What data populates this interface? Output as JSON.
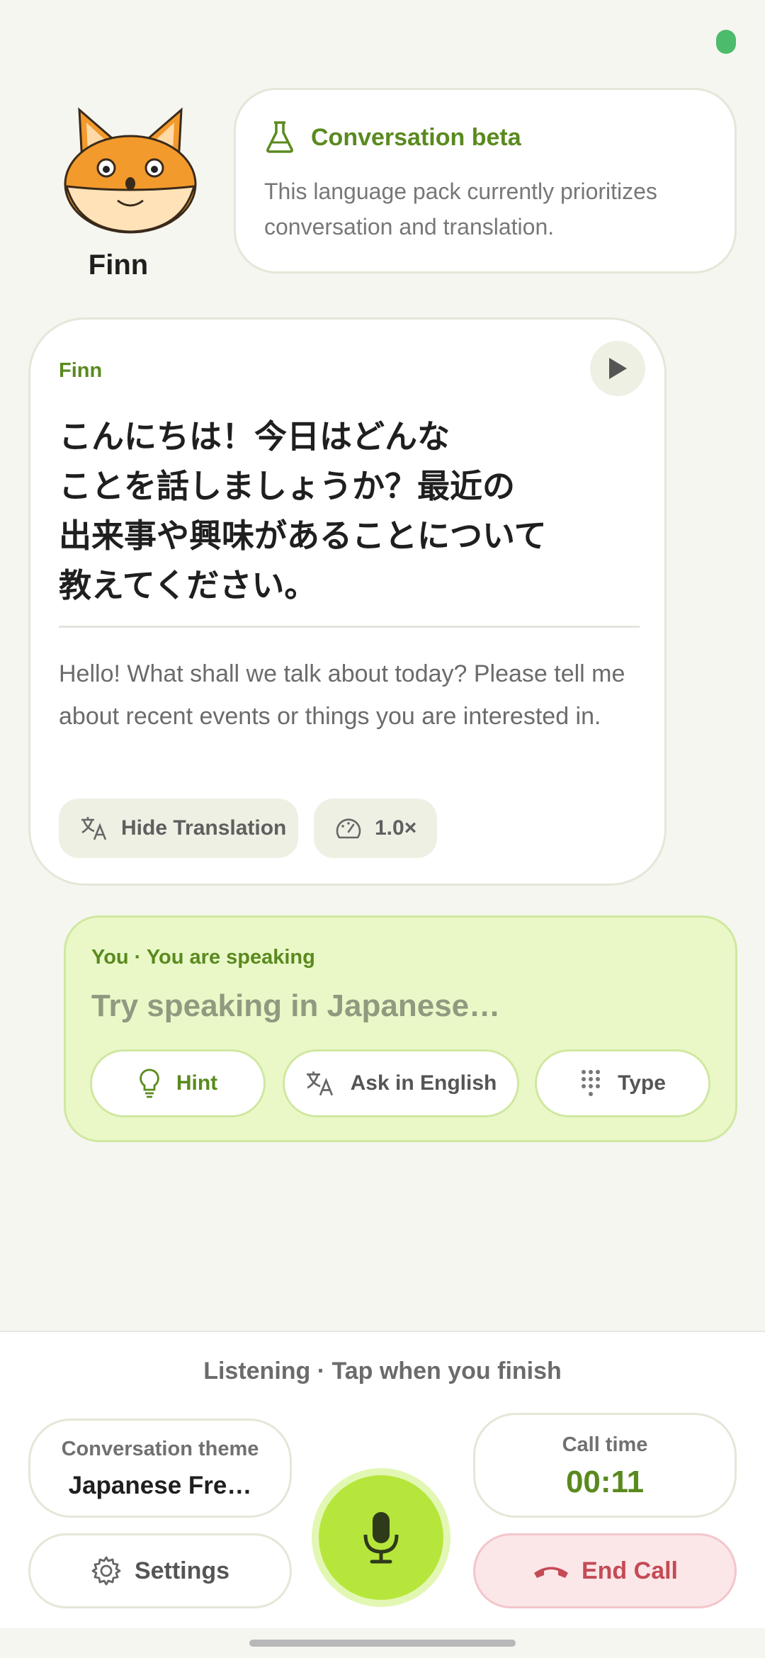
{
  "status": {
    "indicator_color": "#4cbb6b"
  },
  "tutor": {
    "name": "Finn",
    "avatar_icon": "fox-icon"
  },
  "beta_notice": {
    "icon": "flask-icon",
    "title": "Conversation beta",
    "text": "This language pack currently prioritizes conversation and translation."
  },
  "message": {
    "speaker": "Finn",
    "play_icon": "play-icon",
    "japanese_lines": [
      "こんにちは！今日はどんな",
      "ことを話しましょうか？最近の",
      "出来事や興味があることについて",
      "教えてください。"
    ],
    "translation": "Hello! What shall we talk about today? Please tell me about recent events or things you are interested in.",
    "hide_translation_label": "Hide Translation",
    "speed_label": "1.0×"
  },
  "user": {
    "label": "You · You are speaking",
    "placeholder": "Try speaking in Japanese…",
    "hint_label": "Hint",
    "ask_label": "Ask in English",
    "type_label": "Type"
  },
  "bottom": {
    "status": "Listening · Tap when you finish",
    "theme_label": "Conversation theme",
    "theme_value": "Japanese Fre…",
    "call_time_label": "Call time",
    "call_time_value": "00:11",
    "settings_label": "Settings",
    "end_call_label": "End Call"
  },
  "colors": {
    "accent": "#5a8a1e",
    "mic": "#b6e63c",
    "end_call": "#c44a55",
    "user_bubble": "#eaf8c8"
  }
}
